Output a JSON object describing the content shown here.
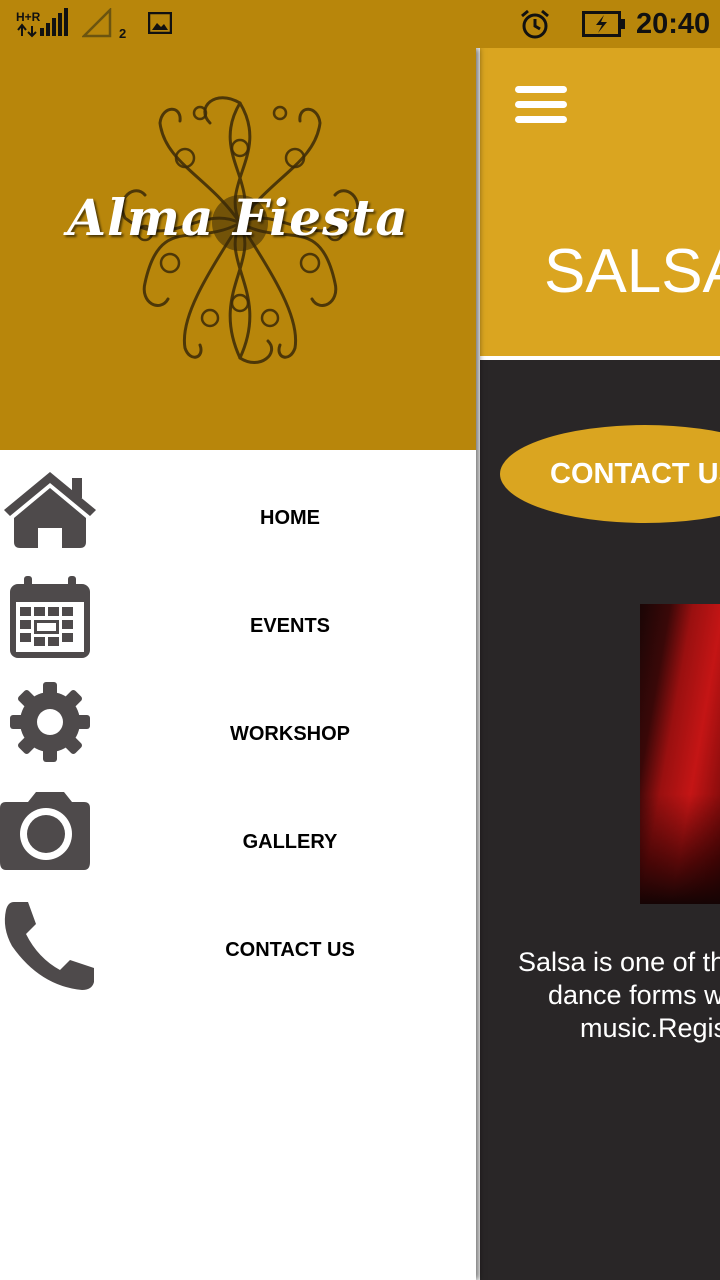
{
  "status_bar": {
    "network_label": "H+R",
    "sim2_label": "2",
    "time": "20:40",
    "icons": [
      "signal-icon",
      "sim2-signal-icon",
      "image-notification-icon",
      "alarm-icon",
      "battery-charging-icon"
    ]
  },
  "drawer": {
    "brand": "Alma Fiesta",
    "items": [
      {
        "label": "HOME",
        "icon": "home-icon"
      },
      {
        "label": "EVENTS",
        "icon": "calendar-icon"
      },
      {
        "label": "WORKSHOP",
        "icon": "gear-icon"
      },
      {
        "label": "GALLERY",
        "icon": "camera-icon"
      },
      {
        "label": "CONTACT US",
        "icon": "phone-icon"
      }
    ]
  },
  "main": {
    "page_title": "SALSA",
    "contact_button": "CONTACT US",
    "description_lines": [
      "Salsa is one of the",
      "dance forms wi",
      "music.Regist"
    ]
  },
  "colors": {
    "header_gold": "#b8860b",
    "topbar_gold": "#daa520",
    "main_bg": "#292627",
    "icon_gray": "#4e4a4b"
  }
}
